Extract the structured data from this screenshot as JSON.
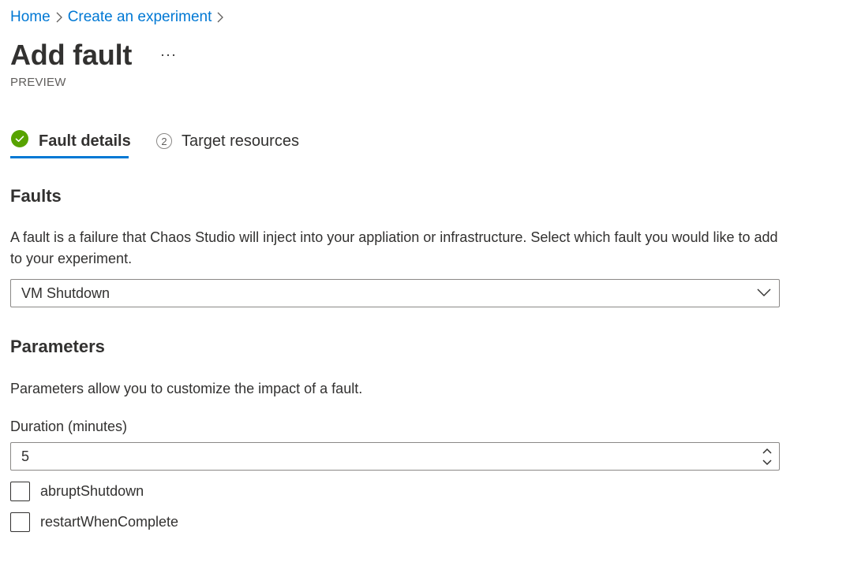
{
  "breadcrumb": {
    "items": [
      {
        "label": "Home"
      },
      {
        "label": "Create an experiment"
      }
    ]
  },
  "header": {
    "title": "Add fault",
    "subtitle": "PREVIEW",
    "more_label": "···"
  },
  "tabs": [
    {
      "label": "Fault details",
      "status": "completed",
      "selected": true
    },
    {
      "label": "Target resources",
      "step": "2",
      "selected": false
    }
  ],
  "faults": {
    "heading": "Faults",
    "description": "A fault is a failure that Chaos Studio will inject into your appliation or infrastructure. Select which fault you would like to add to your experiment.",
    "selected_fault": "VM Shutdown"
  },
  "parameters": {
    "heading": "Parameters",
    "description": "Parameters allow you to customize the impact of a fault.",
    "duration_label": "Duration (minutes)",
    "duration_value": "5",
    "checkboxes": [
      {
        "label": "abruptShutdown",
        "checked": false
      },
      {
        "label": "restartWhenComplete",
        "checked": false
      }
    ]
  },
  "colors": {
    "accent": "#0078d4",
    "success": "#57a300",
    "text": "#323130",
    "border": "#8a8886"
  },
  "icons": {
    "breadcrumb_separator": "chevron-right-icon",
    "tab_complete": "checkmark-circle-icon",
    "dropdown": "chevron-down-icon",
    "spin_up": "chevron-up-icon",
    "spin_down": "chevron-down-icon"
  }
}
